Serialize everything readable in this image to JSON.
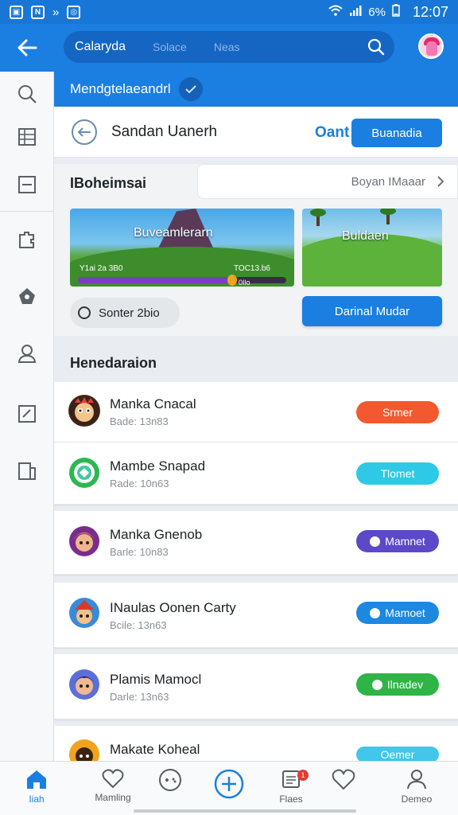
{
  "status_bar": {
    "time": "12:07",
    "battery_text": "6%"
  },
  "app_bar": {
    "search_tabs": [
      "Calaryda",
      "Solace",
      "Neas"
    ]
  },
  "banner": {
    "text": "Mendgtelaeandrl"
  },
  "header_row": {
    "title": "Sandan Uanerh",
    "link_text": "Oant",
    "button_label": "Buanadia"
  },
  "section": {
    "title": "IBoheimsai",
    "dropdown_label": "Boyan IMaaar",
    "card1": {
      "title": "Buveamlerarn",
      "stat_left": "Y1ai 2a 3B0",
      "stat_right": "TOC13.b6",
      "bar_value": "0Ilo",
      "progress": 0.74
    },
    "card2": {
      "title": "Buldaen"
    },
    "chip_label": "Sonter 2bio",
    "action_button": "Darinal Mudar"
  },
  "list_section": {
    "title": "Henedaraion",
    "items": [
      {
        "name": "Manka Cnacal",
        "sub": "Bade: 13n83",
        "action": "Srmer",
        "color": "#f2592e"
      },
      {
        "name": "Mambe Snapad",
        "sub": "Rade: 10n63",
        "action": "Tlomet",
        "color": "#2ec9e6"
      },
      {
        "name": "Manka Gnenob",
        "sub": "Barle: 10n83",
        "action": "Mamnet",
        "color": "#5b49c8"
      },
      {
        "name": "INaulas Oonen Carty",
        "sub": "Bcile: 13n63",
        "action": "Mamoet",
        "color": "#1d88e0"
      },
      {
        "name": "Plamis Mamocl",
        "sub": "Darle: 13n63",
        "action": "Ilnadev",
        "color": "#2fb545"
      },
      {
        "name": "Makate Koheal",
        "sub": "",
        "action": "Oemer",
        "color": "#42c6ea"
      }
    ]
  },
  "bottom_nav": {
    "items": [
      {
        "label": "Iiah"
      },
      {
        "label": "Mamling"
      },
      {
        "label": ""
      },
      {
        "label": ""
      },
      {
        "label": "Flaes"
      },
      {
        "label": ""
      },
      {
        "label": "Demeo"
      }
    ],
    "badge": "1"
  }
}
